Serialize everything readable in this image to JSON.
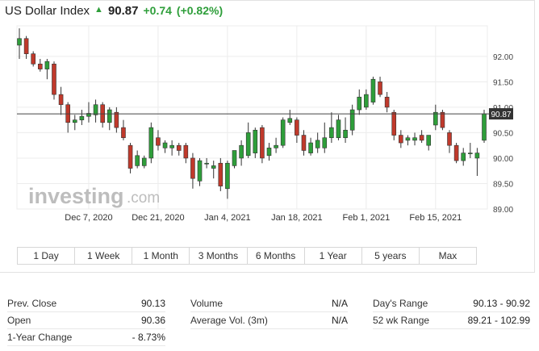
{
  "header": {
    "name": "US Dollar Index",
    "price": "90.87",
    "change": "+0.74",
    "change_pct": "(+0.82%)"
  },
  "colors": {
    "up": "#2e9e3a",
    "down": "#c0392b",
    "grid": "#ececec",
    "price_line": "#444444"
  },
  "watermark": {
    "brand": "investing",
    "suffix": ".com"
  },
  "tabs": [
    "1 Day",
    "1 Week",
    "1 Month",
    "3 Months",
    "6 Months",
    "1 Year",
    "5 years",
    "Max"
  ],
  "stats": [
    [
      {
        "label": "Prev. Close",
        "value": "90.13"
      },
      {
        "label": "Volume",
        "value": "N/A"
      },
      {
        "label": "Day's Range",
        "value": "90.13 - 90.92"
      }
    ],
    [
      {
        "label": "Open",
        "value": "90.36"
      },
      {
        "label": "Average Vol. (3m)",
        "value": "N/A"
      },
      {
        "label": "52 wk Range",
        "value": "89.21 - 102.99"
      }
    ],
    [
      {
        "label": "1-Year Change",
        "value": "- 8.73%"
      },
      {
        "label": "",
        "value": ""
      },
      {
        "label": "",
        "value": ""
      }
    ]
  ],
  "chart_data": {
    "type": "candlestick",
    "ylim": [
      89.0,
      92.6
    ],
    "y_ticks": [
      "92.00",
      "91.50",
      "91.00",
      "90.50",
      "90.00",
      "89.50",
      "89.00"
    ],
    "x_ticks": [
      "Dec 7, 2020",
      "Dec 21, 2020",
      "Jan 4, 2021",
      "Jan 18, 2021",
      "Feb 1, 2021",
      "Feb 15, 2021"
    ],
    "current_price": "90.87",
    "grid": true,
    "candles": [
      {
        "o": 92.22,
        "h": 92.55,
        "l": 91.95,
        "c": 92.35
      },
      {
        "o": 92.35,
        "h": 92.4,
        "l": 91.95,
        "c": 92.05
      },
      {
        "o": 92.05,
        "h": 92.1,
        "l": 91.8,
        "c": 91.85
      },
      {
        "o": 91.85,
        "h": 91.95,
        "l": 91.7,
        "c": 91.75
      },
      {
        "o": 91.75,
        "h": 91.95,
        "l": 91.55,
        "c": 91.9
      },
      {
        "o": 91.85,
        "h": 91.9,
        "l": 91.15,
        "c": 91.25
      },
      {
        "o": 91.25,
        "h": 91.4,
        "l": 90.85,
        "c": 91.05
      },
      {
        "o": 91.05,
        "h": 91.1,
        "l": 90.5,
        "c": 90.7
      },
      {
        "o": 90.7,
        "h": 90.85,
        "l": 90.55,
        "c": 90.75
      },
      {
        "o": 90.75,
        "h": 90.95,
        "l": 90.65,
        "c": 90.82
      },
      {
        "o": 90.82,
        "h": 91.1,
        "l": 90.7,
        "c": 90.88
      },
      {
        "o": 90.85,
        "h": 91.15,
        "l": 90.7,
        "c": 91.05
      },
      {
        "o": 91.05,
        "h": 91.1,
        "l": 90.6,
        "c": 90.7
      },
      {
        "o": 90.7,
        "h": 91.0,
        "l": 90.55,
        "c": 90.95
      },
      {
        "o": 90.9,
        "h": 91.0,
        "l": 90.5,
        "c": 90.6
      },
      {
        "o": 90.6,
        "h": 90.75,
        "l": 90.35,
        "c": 90.4
      },
      {
        "o": 90.25,
        "h": 90.3,
        "l": 89.7,
        "c": 89.8
      },
      {
        "o": 89.85,
        "h": 90.15,
        "l": 89.8,
        "c": 90.05
      },
      {
        "o": 89.85,
        "h": 90.05,
        "l": 89.8,
        "c": 90.0
      },
      {
        "o": 90.0,
        "h": 90.7,
        "l": 89.9,
        "c": 90.6
      },
      {
        "o": 90.4,
        "h": 90.55,
        "l": 90.15,
        "c": 90.25
      },
      {
        "o": 90.2,
        "h": 90.35,
        "l": 90.1,
        "c": 90.3
      },
      {
        "o": 90.2,
        "h": 90.35,
        "l": 90.05,
        "c": 90.25
      },
      {
        "o": 90.25,
        "h": 90.3,
        "l": 90.05,
        "c": 90.15
      },
      {
        "o": 90.25,
        "h": 90.3,
        "l": 89.9,
        "c": 90.0
      },
      {
        "o": 90.0,
        "h": 90.1,
        "l": 89.4,
        "c": 89.6
      },
      {
        "o": 89.55,
        "h": 90.0,
        "l": 89.45,
        "c": 89.95
      },
      {
        "o": 89.9,
        "h": 90.0,
        "l": 89.8,
        "c": 89.9
      },
      {
        "o": 89.8,
        "h": 89.95,
        "l": 89.6,
        "c": 89.85
      },
      {
        "o": 89.9,
        "h": 90.0,
        "l": 89.35,
        "c": 89.45
      },
      {
        "o": 89.4,
        "h": 89.95,
        "l": 89.2,
        "c": 89.9
      },
      {
        "o": 89.85,
        "h": 90.15,
        "l": 89.8,
        "c": 90.15
      },
      {
        "o": 90.0,
        "h": 90.35,
        "l": 89.85,
        "c": 90.25
      },
      {
        "o": 90.05,
        "h": 90.7,
        "l": 90.0,
        "c": 90.5
      },
      {
        "o": 90.1,
        "h": 90.6,
        "l": 90.0,
        "c": 90.55
      },
      {
        "o": 90.6,
        "h": 90.65,
        "l": 89.9,
        "c": 90.0
      },
      {
        "o": 90.05,
        "h": 90.3,
        "l": 89.95,
        "c": 90.2
      },
      {
        "o": 90.2,
        "h": 90.4,
        "l": 90.1,
        "c": 90.25
      },
      {
        "o": 90.25,
        "h": 90.8,
        "l": 90.2,
        "c": 90.75
      },
      {
        "o": 90.7,
        "h": 90.95,
        "l": 90.65,
        "c": 90.78
      },
      {
        "o": 90.75,
        "h": 90.8,
        "l": 90.3,
        "c": 90.45
      },
      {
        "o": 90.45,
        "h": 90.55,
        "l": 90.05,
        "c": 90.15
      },
      {
        "o": 90.1,
        "h": 90.4,
        "l": 90.05,
        "c": 90.3
      },
      {
        "o": 90.2,
        "h": 90.5,
        "l": 90.1,
        "c": 90.35
      },
      {
        "o": 90.2,
        "h": 90.7,
        "l": 90.1,
        "c": 90.4
      },
      {
        "o": 90.4,
        "h": 90.9,
        "l": 90.3,
        "c": 90.6
      },
      {
        "o": 90.4,
        "h": 90.85,
        "l": 90.35,
        "c": 90.75
      },
      {
        "o": 90.4,
        "h": 90.8,
        "l": 90.3,
        "c": 90.55
      },
      {
        "o": 90.55,
        "h": 91.05,
        "l": 90.45,
        "c": 90.95
      },
      {
        "o": 90.95,
        "h": 91.35,
        "l": 90.85,
        "c": 91.2
      },
      {
        "o": 91.0,
        "h": 91.35,
        "l": 90.95,
        "c": 91.25
      },
      {
        "o": 91.1,
        "h": 91.6,
        "l": 91.05,
        "c": 91.55
      },
      {
        "o": 91.5,
        "h": 91.6,
        "l": 91.2,
        "c": 91.25
      },
      {
        "o": 91.2,
        "h": 91.3,
        "l": 90.9,
        "c": 91.0
      },
      {
        "o": 90.9,
        "h": 90.95,
        "l": 90.35,
        "c": 90.45
      },
      {
        "o": 90.45,
        "h": 90.55,
        "l": 90.2,
        "c": 90.3
      },
      {
        "o": 90.35,
        "h": 90.45,
        "l": 90.25,
        "c": 90.4
      },
      {
        "o": 90.35,
        "h": 90.5,
        "l": 90.25,
        "c": 90.4
      },
      {
        "o": 90.45,
        "h": 90.55,
        "l": 90.3,
        "c": 90.35
      },
      {
        "o": 90.25,
        "h": 90.45,
        "l": 90.15,
        "c": 90.45
      },
      {
        "o": 90.65,
        "h": 91.05,
        "l": 90.55,
        "c": 90.9
      },
      {
        "o": 90.9,
        "h": 90.95,
        "l": 90.55,
        "c": 90.6
      },
      {
        "o": 90.5,
        "h": 90.55,
        "l": 90.1,
        "c": 90.25
      },
      {
        "o": 90.25,
        "h": 90.3,
        "l": 89.9,
        "c": 89.95
      },
      {
        "o": 89.95,
        "h": 90.2,
        "l": 89.85,
        "c": 90.1
      },
      {
        "o": 90.1,
        "h": 90.3,
        "l": 90.0,
        "c": 90.1
      },
      {
        "o": 90.0,
        "h": 90.2,
        "l": 89.65,
        "c": 90.1
      },
      {
        "o": 90.35,
        "h": 90.95,
        "l": 90.3,
        "c": 90.87
      }
    ]
  }
}
